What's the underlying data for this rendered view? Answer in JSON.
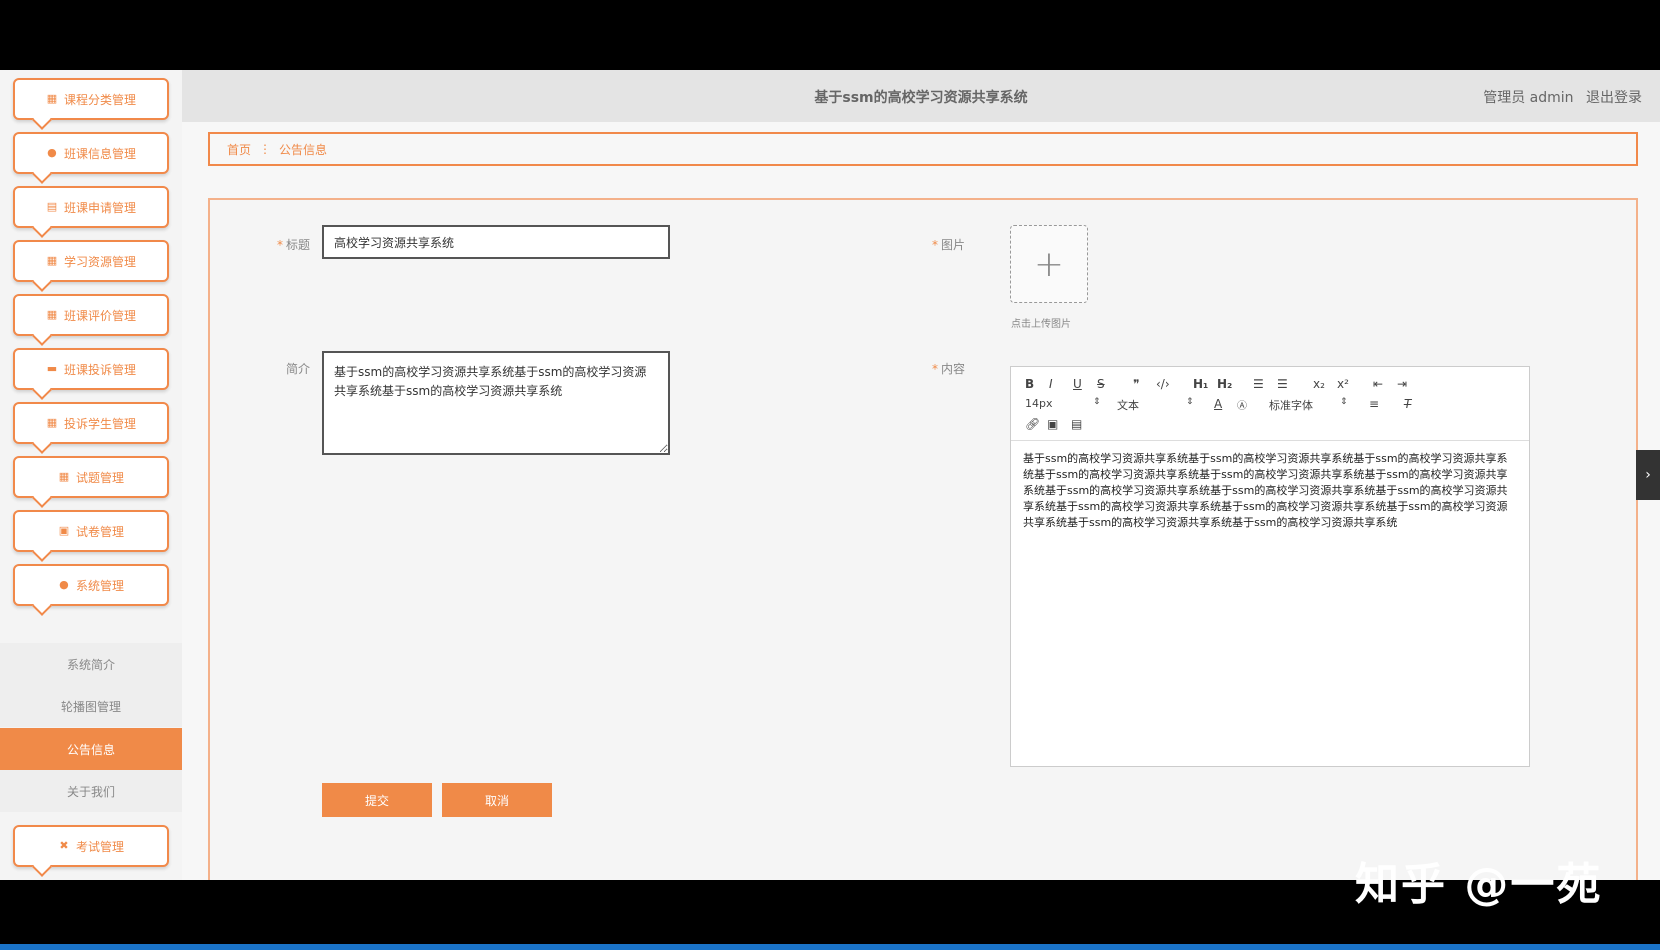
{
  "app": {
    "title": "基于ssm的高校学习资源共享系统",
    "user_label": "管理员 admin",
    "logout_label": "退出登录"
  },
  "sidebar": {
    "items": [
      {
        "label": "课程分类管理",
        "icon": "grid-icon"
      },
      {
        "label": "班课信息管理",
        "icon": "user-icon"
      },
      {
        "label": "班课申请管理",
        "icon": "chart-icon"
      },
      {
        "label": "学习资源管理",
        "icon": "grid-icon"
      },
      {
        "label": "班课评价管理",
        "icon": "grid-icon"
      },
      {
        "label": "班课投诉管理",
        "icon": "chat-icon"
      },
      {
        "label": "投诉学生管理",
        "icon": "grid-icon"
      },
      {
        "label": "试题管理",
        "icon": "grid-icon"
      },
      {
        "label": "试卷管理",
        "icon": "clipboard-icon"
      },
      {
        "label": "系统管理",
        "icon": "user-icon"
      }
    ],
    "sub_items": [
      {
        "label": "系统简介"
      },
      {
        "label": "轮播图管理"
      },
      {
        "label": "公告信息"
      },
      {
        "label": "关于我们"
      }
    ],
    "last_item": {
      "label": "考试管理",
      "icon": "exam-icon"
    },
    "active_sub": "公告信息",
    "accent_color": "#f08a48"
  },
  "breadcrumb": {
    "home": "首页",
    "current": "公告信息"
  },
  "form": {
    "title_label": "标题",
    "title_value": "高校学习资源共享系统",
    "intro_label": "简介",
    "intro_value": "基于ssm的高校学习资源共享系统基于ssm的高校学习资源共享系统基于ssm的高校学习资源共享系统",
    "image_label": "图片",
    "upload_hint": "点击上传图片",
    "content_label": "内容",
    "content_value": "基于ssm的高校学习资源共享系统基于ssm的高校学习资源共享系统基于ssm的高校学习资源共享系统基于ssm的高校学习资源共享系统基于ssm的高校学习资源共享系统基于ssm的高校学习资源共享系统基于ssm的高校学习资源共享系统基于ssm的高校学习资源共享系统基于ssm的高校学习资源共享系统基于ssm的高校学习资源共享系统基于ssm的高校学习资源共享系统基于ssm的高校学习资源共享系统基于ssm的高校学习资源共享系统基于ssm的高校学习资源共享系统",
    "submit_label": "提交",
    "cancel_label": "取消"
  },
  "editor": {
    "font_size": "14px",
    "block_type": "文本",
    "font_family": "标准字体"
  },
  "watermark": "知乎 @一苑"
}
